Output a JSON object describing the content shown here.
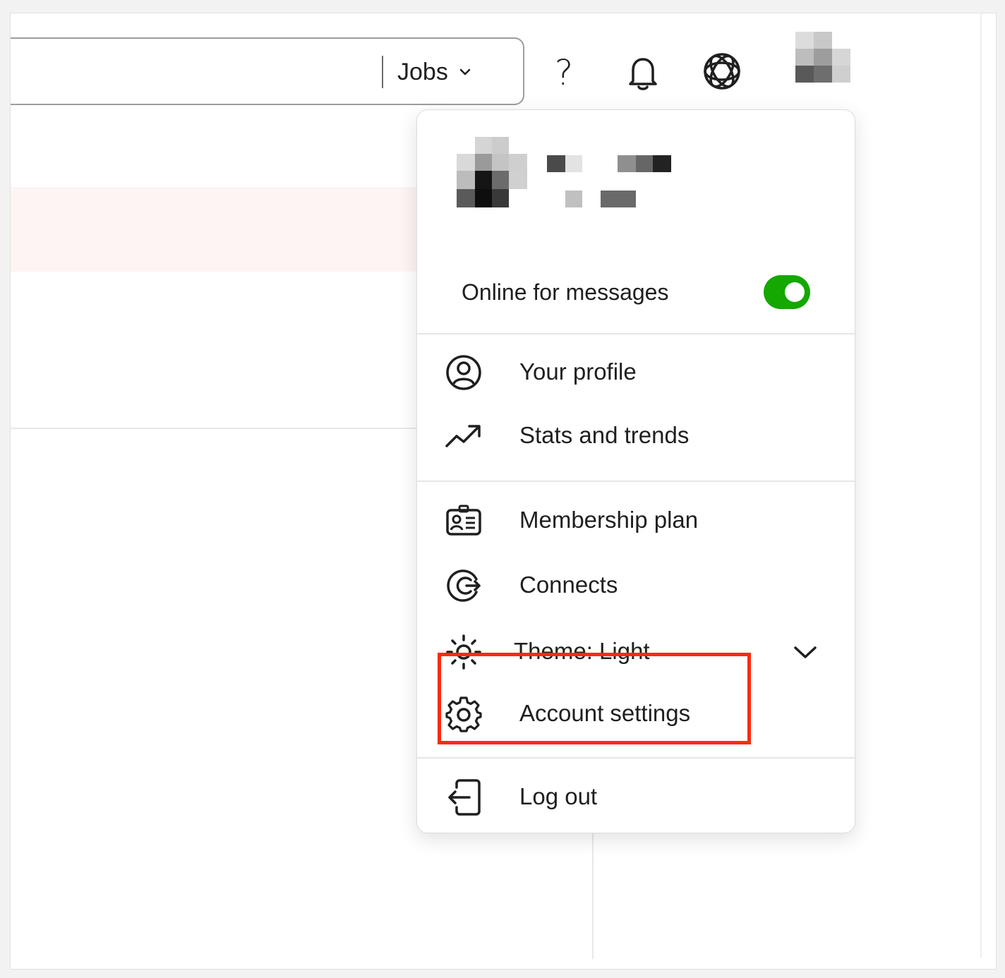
{
  "header": {
    "search_scope_label": "Jobs",
    "help_label": "?",
    "icons": [
      "chevron-down-icon",
      "help-icon",
      "bell-icon",
      "network-icon",
      "avatar"
    ]
  },
  "menu": {
    "online": {
      "label": "Online for messages",
      "enabled": true,
      "toggle_color": "#14a800"
    },
    "items_group1": [
      {
        "label": "Your profile",
        "icon": "user-circle-icon"
      },
      {
        "label": "Stats and trends",
        "icon": "trend-up-icon"
      }
    ],
    "items_group2": [
      {
        "label": "Membership plan",
        "icon": "id-badge-icon"
      },
      {
        "label": "Connects",
        "icon": "connects-icon"
      },
      {
        "label": "Theme: Light",
        "icon": "sun-icon"
      },
      {
        "label": "Account settings",
        "icon": "gear-icon"
      }
    ],
    "logout": {
      "label": "Log out",
      "icon": "logout-icon"
    }
  },
  "annotation": {
    "highlight_color": "#ff2a0f",
    "highlighted_item": "Account settings"
  }
}
